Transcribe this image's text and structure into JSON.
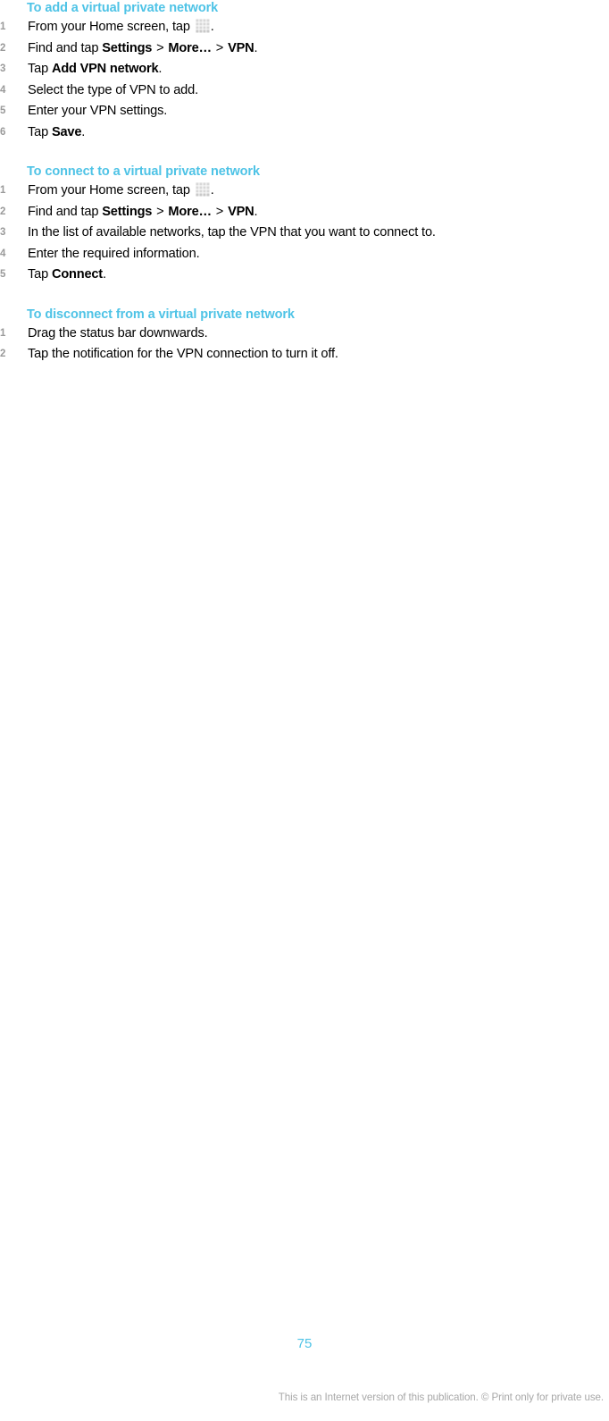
{
  "document": {
    "page_number": "75",
    "footer_note": "This is an Internet version of this publication. © Print only for private use.",
    "heading_color": "#4ec3e6",
    "number_color": "#9a9a9a",
    "body_color": "#000000",
    "footer_color": "#a8a8a8"
  },
  "sections": [
    {
      "heading": "To add a virtual private network",
      "steps": [
        {
          "number": "1",
          "parts": [
            {
              "type": "text",
              "value": "From your Home screen, tap "
            },
            {
              "type": "icon",
              "value": "app-drawer-icon"
            },
            {
              "type": "text",
              "value": "."
            }
          ]
        },
        {
          "number": "2",
          "parts": [
            {
              "type": "text",
              "value": "Find and tap "
            },
            {
              "type": "bold",
              "value": "Settings"
            },
            {
              "type": "sep",
              "value": ">"
            },
            {
              "type": "bold",
              "value": "More…"
            },
            {
              "type": "sep",
              "value": ">"
            },
            {
              "type": "bold",
              "value": "VPN"
            },
            {
              "type": "text",
              "value": "."
            }
          ]
        },
        {
          "number": "3",
          "parts": [
            {
              "type": "text",
              "value": "Tap "
            },
            {
              "type": "bold",
              "value": "Add VPN network"
            },
            {
              "type": "text",
              "value": "."
            }
          ]
        },
        {
          "number": "4",
          "parts": [
            {
              "type": "text",
              "value": "Select the type of VPN to add."
            }
          ]
        },
        {
          "number": "5",
          "parts": [
            {
              "type": "text",
              "value": "Enter your VPN settings."
            }
          ]
        },
        {
          "number": "6",
          "parts": [
            {
              "type": "text",
              "value": "Tap "
            },
            {
              "type": "bold",
              "value": "Save"
            },
            {
              "type": "text",
              "value": "."
            }
          ]
        }
      ]
    },
    {
      "heading": "To connect to a virtual private network",
      "steps": [
        {
          "number": "1",
          "parts": [
            {
              "type": "text",
              "value": "From your Home screen, tap "
            },
            {
              "type": "icon",
              "value": "app-drawer-icon"
            },
            {
              "type": "text",
              "value": "."
            }
          ]
        },
        {
          "number": "2",
          "parts": [
            {
              "type": "text",
              "value": "Find and tap "
            },
            {
              "type": "bold",
              "value": "Settings"
            },
            {
              "type": "sep",
              "value": ">"
            },
            {
              "type": "bold",
              "value": "More…"
            },
            {
              "type": "sep",
              "value": ">"
            },
            {
              "type": "bold",
              "value": "VPN"
            },
            {
              "type": "text",
              "value": "."
            }
          ]
        },
        {
          "number": "3",
          "parts": [
            {
              "type": "text",
              "value": "In the list of available networks, tap the VPN that you want to connect to."
            }
          ]
        },
        {
          "number": "4",
          "parts": [
            {
              "type": "text",
              "value": "Enter the required information."
            }
          ]
        },
        {
          "number": "5",
          "parts": [
            {
              "type": "text",
              "value": "Tap "
            },
            {
              "type": "bold",
              "value": "Connect"
            },
            {
              "type": "text",
              "value": "."
            }
          ]
        }
      ]
    },
    {
      "heading": "To disconnect from a virtual private network",
      "steps": [
        {
          "number": "1",
          "parts": [
            {
              "type": "text",
              "value": "Drag the status bar downwards."
            }
          ]
        },
        {
          "number": "2",
          "parts": [
            {
              "type": "text",
              "value": "Tap the notification for the VPN connection to turn it off."
            }
          ]
        }
      ]
    }
  ]
}
